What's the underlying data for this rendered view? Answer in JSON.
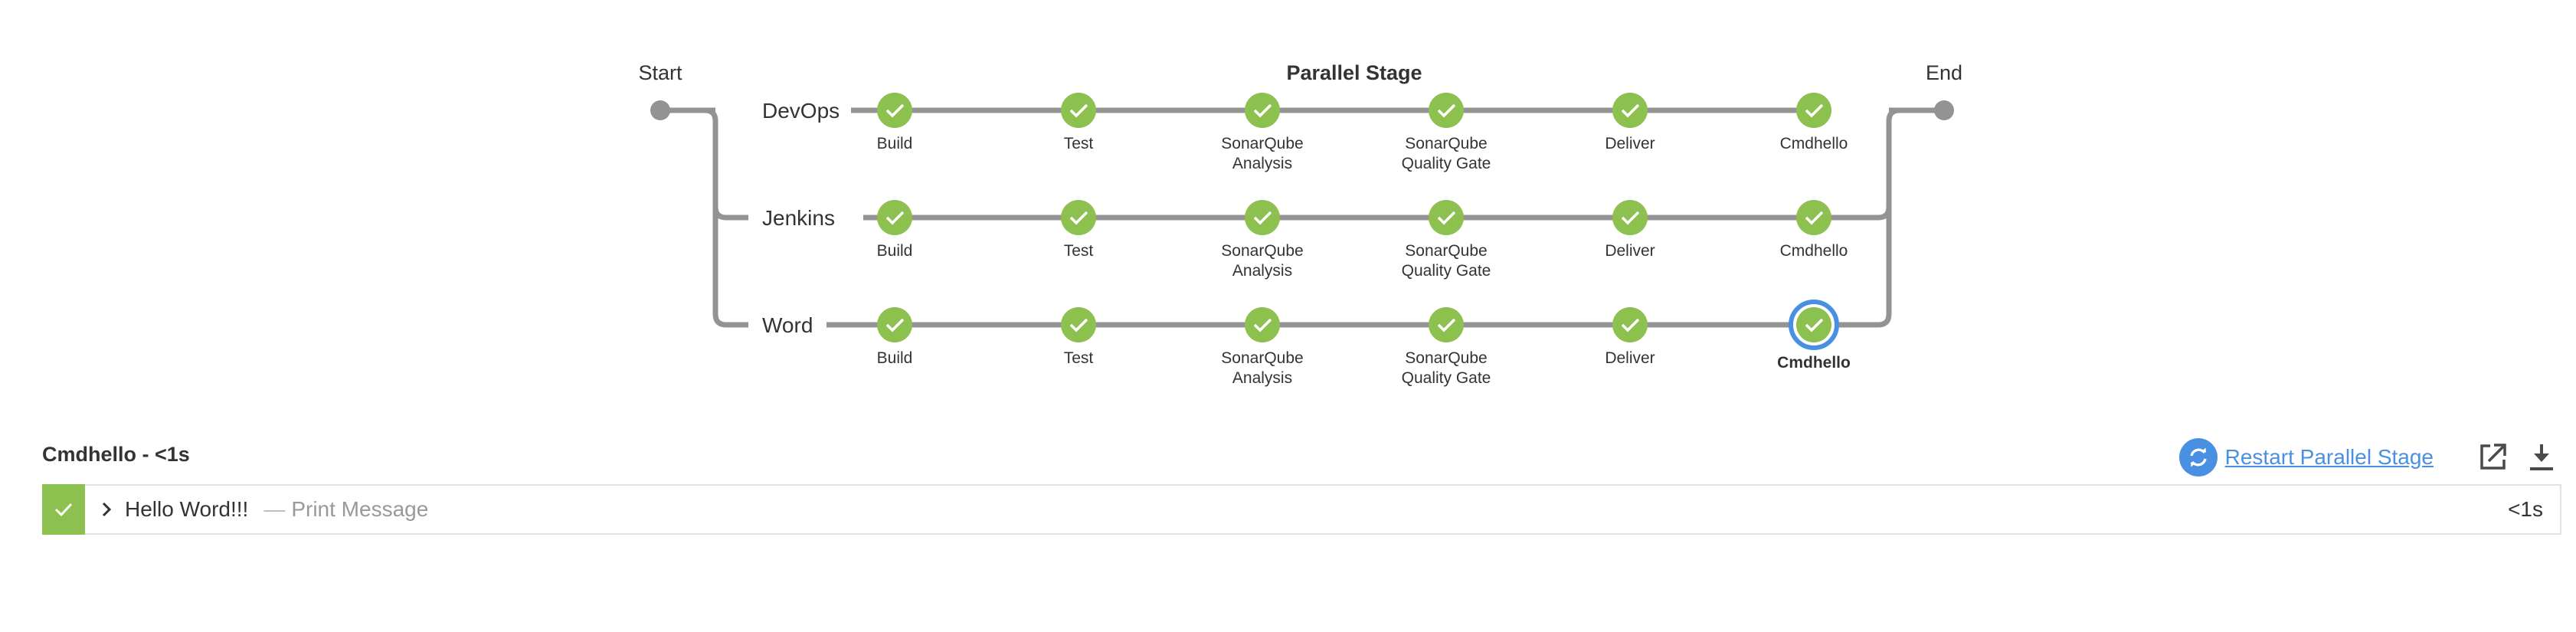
{
  "pipeline": {
    "start_label": "Start",
    "end_label": "End",
    "parallel_label": "Parallel Stage",
    "stage_status": "success",
    "selected": {
      "branch": 2,
      "stage": 5
    },
    "stages": [
      "Build",
      "Test",
      "SonarQube\nAnalysis",
      "SonarQube\nQuality Gate",
      "Deliver",
      "Cmdhello"
    ],
    "branches": [
      {
        "name": "DevOps"
      },
      {
        "name": "Jenkins"
      },
      {
        "name": "Word"
      }
    ]
  },
  "detail": {
    "title": "Cmdhello - <1s",
    "restart_label": "Restart Parallel Stage",
    "step": {
      "status": "success",
      "text": "Hello Word!!!",
      "description": "Print Message",
      "duration": "<1s"
    }
  },
  "colors": {
    "success": "#8cc04f",
    "link": "#4a90e2",
    "connector": "#949393",
    "selected_ring": "#4a90e2"
  },
  "icons": {
    "restart": "restart-icon",
    "open_external": "open-external-icon",
    "download": "download-icon",
    "check": "check-icon",
    "chevron": "chevron-right-icon"
  }
}
